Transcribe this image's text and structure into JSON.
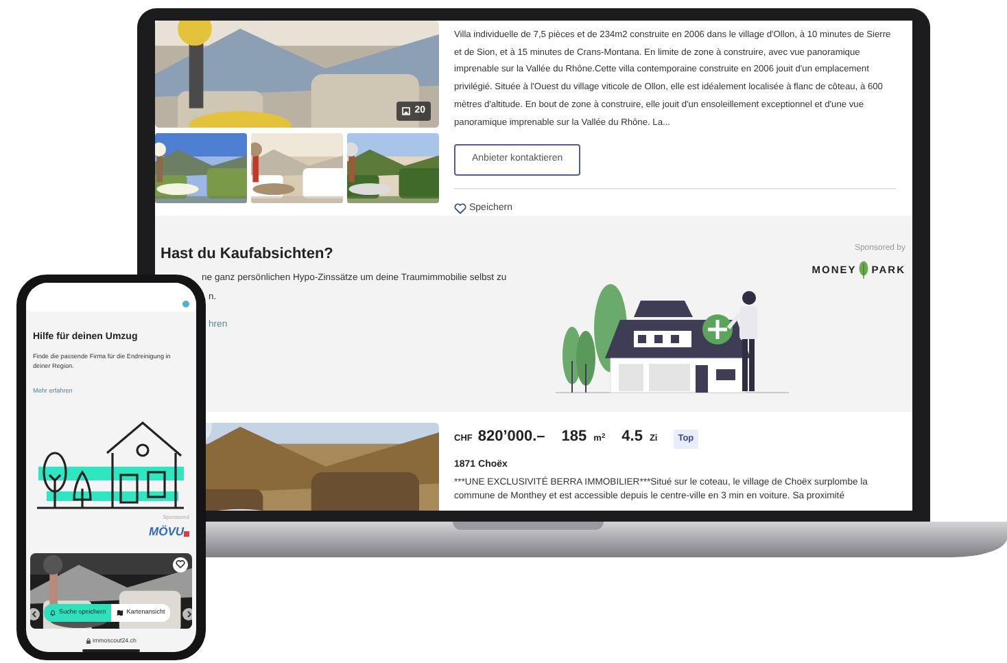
{
  "laptop_screen": {
    "listing_1": {
      "photo_count": "20",
      "description": "Villa individuelle de 7,5 pièces et de 234m2 construite en 2006 dans le village d'Ollon, à 10 minutes de Sierre et de Sion, et à 15 minutes de Crans-Montana. En limite de zone à construire, avec vue panoramique imprenable sur la Vallée du Rhône.Cette villa contemporaine construite en 2006 jouit d'un emplacement privilégié. Située à l'Ouest du village viticole de Ollon, elle est idéalement localisée à flanc de côteau, à 600 mètres d'altitude. En bout de zone à construire, elle jouit d'un ensoleillement exceptionnel et d'une vue panoramique imprenable sur la Vallée du Rhône. La...",
      "contact_button": "Anbieter kontaktieren",
      "save_button": "Speichern"
    },
    "ad": {
      "title": "Hast du Kaufabsichten?",
      "text_lines": [
        "ne ganz persönlichen Hypo-Zinssätze um deine Traumimmobilie selbst zu",
        "n."
      ],
      "link": "hren",
      "sponsor_label": "Sponsored by",
      "sponsor_logo": [
        "MONEY",
        "PARK"
      ]
    },
    "listing_2": {
      "currency": "CHF",
      "price": "820’000.–",
      "area": "185",
      "area_unit": "m$^{2}$",
      "rooms": "4.5",
      "rooms_unit": "Zi",
      "badge": "Top",
      "location": "1871 Choëx",
      "description": "***UNE EXCLUSIVITÉ BERRA IMMOBILIER***Situé sur le coteau, le village de Choëx surplombe la commune de Monthey et est accessible depuis le centre-ville en 3 min en voiture. Sa proximité"
    }
  },
  "phone_screen": {
    "ad": {
      "title": "Hilfe für deinen Umzug",
      "text": "Finde die passende Firma für die Endreinigung in deiner Region.",
      "link": "Mehr erfahren",
      "sponsor_label": "Sponsored",
      "sponsor_logo": "MÖVU"
    },
    "actions": [
      {
        "label": "Suche speichern",
        "kind": "bell"
      },
      {
        "label": "Kartenansicht",
        "kind": "map"
      }
    ],
    "url": "immoscout24.ch"
  }
}
